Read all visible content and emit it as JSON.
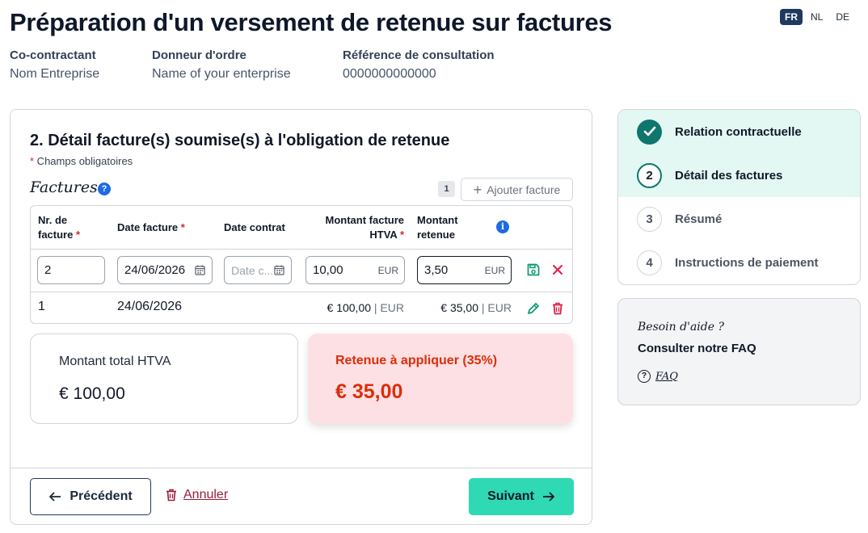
{
  "page": {
    "title": "Préparation d'un versement de retenue sur factures"
  },
  "languages": [
    {
      "code": "FR",
      "active": true
    },
    {
      "code": "NL",
      "active": false
    },
    {
      "code": "DE",
      "active": false
    }
  ],
  "meta": {
    "cocontractant_label": "Co-contractant",
    "cocontractant_value": "Nom Entreprise",
    "donneur_label": "Donneur d'ordre",
    "donneur_value": "Name of your enterprise",
    "reference_label": "Référence de consultation",
    "reference_value": "0000000000000"
  },
  "section": {
    "title": "2. Détail facture(s) soumise(s) à l'obligation de retenue",
    "required_star": "*",
    "required_text": " Champs obligatoires",
    "invoices_label": "Factures",
    "help_icon_glyph": "?",
    "invoice_count": "1",
    "add_invoice_label": "Ajouter facture"
  },
  "table": {
    "headers": {
      "nr_line1": "Nr. de",
      "nr_line2": "facture",
      "date": "Date facture",
      "contract": "Date contrat",
      "amount_line1": "Montant facture",
      "amount_line2": "HTVA",
      "retenue_line1": "Montant",
      "retenue_line2": "retenue",
      "star": "*"
    },
    "info_glyph": "i",
    "edit_row": {
      "nr": "2",
      "date": "24/06/2026",
      "contract_placeholder": "Date c...",
      "amount": "10,00",
      "amount_unit": "EUR",
      "retenue": "3,50",
      "retenue_unit": "EUR"
    },
    "rows": [
      {
        "nr": "1",
        "date": "24/06/2026",
        "amount": "€ 100,00",
        "retenue": "€ 35,00",
        "unit": " | EUR"
      }
    ]
  },
  "totals": {
    "total_label": "Montant total HTVA",
    "total_value": "€ 100,00",
    "retenue_label": "Retenue à appliquer (35%)",
    "retenue_value": "€ 35,00"
  },
  "footer": {
    "prev_label": "Précédent",
    "cancel_label": "Annuler",
    "next_label": "Suivant"
  },
  "steps": [
    {
      "number": "",
      "label": "Relation contractuelle",
      "state": "done"
    },
    {
      "number": "2",
      "label": "Détail des factures",
      "state": "current"
    },
    {
      "number": "3",
      "label": "Résumé",
      "state": "todo"
    },
    {
      "number": "4",
      "label": "Instructions de paiement",
      "state": "todo"
    }
  ],
  "help": {
    "title": "Besoin d'aide ?",
    "subtitle": "Consulter notre FAQ",
    "faq_glyph": "?",
    "faq_link": "FAQ"
  },
  "colors": {
    "brand_dark": "#1e3a5f",
    "accent_teal": "#2ed9b3",
    "step_bg": "#e3f8f3",
    "retenue_bg": "#fde0e3",
    "retenue_text": "#dc2e0a",
    "cancel_text": "#9b1c3a"
  }
}
